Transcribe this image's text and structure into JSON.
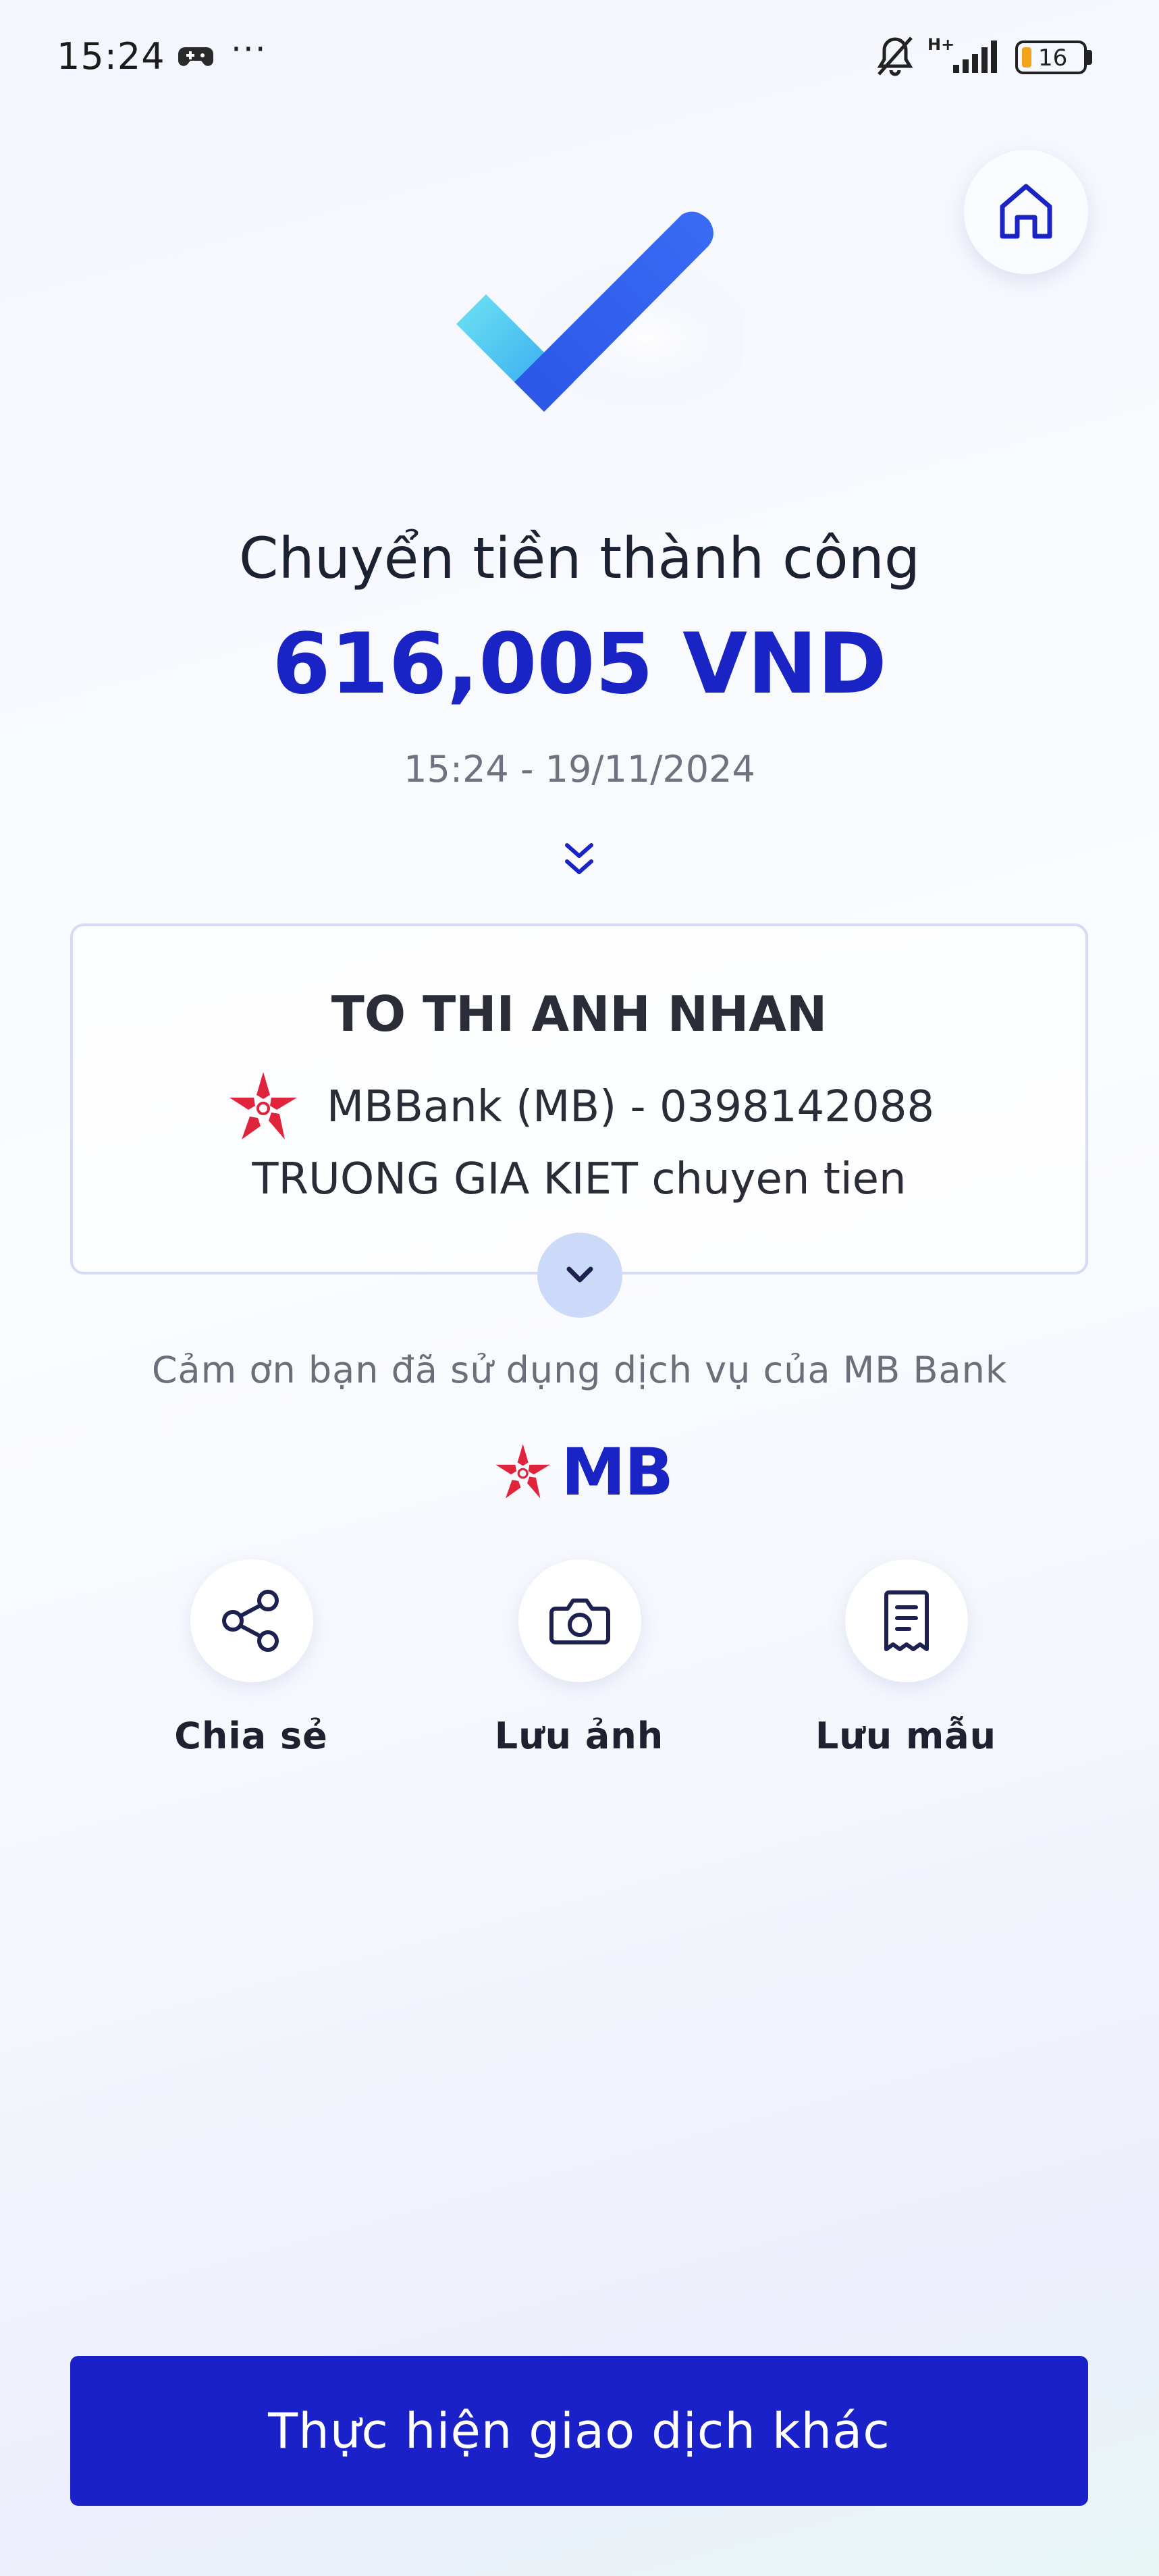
{
  "status_bar": {
    "time": "15:24",
    "more": "···",
    "network": "H+",
    "battery": "16",
    "battery_color": "#f2a31b"
  },
  "home": {
    "icon": "home-icon"
  },
  "result": {
    "icon": "check-icon",
    "title": "Chuyển tiền thành công",
    "amount": "616,005 VND",
    "datetime": "15:24 - 19/11/2024",
    "expand_icon": "double-chevron-down-icon"
  },
  "recipient": {
    "name": "TO THI ANH NHAN",
    "bank": "MBBank (MB) - 0398142088",
    "note": "TRUONG GIA KIET chuyen tien",
    "bank_logo_icon": "mb-star-icon",
    "expand_icon": "chevron-down-icon"
  },
  "thanks": "Cảm ơn bạn đã sử dụng dịch vụ của MB Bank",
  "logo": {
    "text": "MB",
    "brand_color": "#1a24c4",
    "star_color": "#e0243c"
  },
  "actions": [
    {
      "label": "Chia sẻ",
      "icon": "share-icon"
    },
    {
      "label": "Lưu ảnh",
      "icon": "camera-icon"
    },
    {
      "label": "Lưu mẫu",
      "icon": "receipt-icon"
    }
  ],
  "primary_button": {
    "label": "Thực hiện giao dịch khác",
    "color": "#1a21c9"
  }
}
